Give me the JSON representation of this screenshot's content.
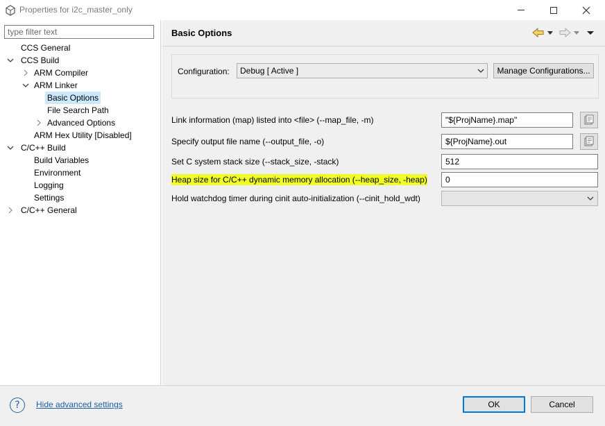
{
  "window": {
    "title": "Properties for i2c_master_only"
  },
  "sidebar": {
    "filter_placeholder": "type filter text",
    "items": [
      {
        "label": "CCS General"
      },
      {
        "label": "CCS Build"
      },
      {
        "label": "ARM Compiler"
      },
      {
        "label": "ARM Linker"
      },
      {
        "label": "Basic Options"
      },
      {
        "label": "File Search Path"
      },
      {
        "label": "Advanced Options"
      },
      {
        "label": "ARM Hex Utility  [Disabled]"
      },
      {
        "label": "C/C++ Build"
      },
      {
        "label": "Build Variables"
      },
      {
        "label": "Environment"
      },
      {
        "label": "Logging"
      },
      {
        "label": "Settings"
      },
      {
        "label": "C/C++ General"
      }
    ],
    "selected": "Basic Options"
  },
  "page": {
    "title": "Basic Options",
    "configuration": {
      "label": "Configuration:",
      "value": "Debug  [ Active ]",
      "manage_label": "Manage Configurations..."
    },
    "options": [
      {
        "label": "Link information (map) listed into <file> (--map_file, -m)",
        "value": "\"${ProjName}.map\""
      },
      {
        "label": "Specify output file name (--output_file, -o)",
        "value": "${ProjName}.out"
      },
      {
        "label": "Set C system stack size (--stack_size, -stack)",
        "value": "512"
      },
      {
        "label": "Heap size for C/C++ dynamic memory allocation (--heap_size, -heap)",
        "value": "0"
      },
      {
        "label": "Hold watchdog timer during cinit auto-initialization (--cinit_hold_wdt)",
        "value": ""
      }
    ]
  },
  "footer": {
    "help_link": "Hide advanced settings",
    "ok_label": "OK",
    "cancel_label": "Cancel"
  },
  "colors": {
    "highlight": "#f0ff26",
    "link": "#1c5fa8",
    "selection": "#cce8ff",
    "focus": "#0078d7"
  }
}
